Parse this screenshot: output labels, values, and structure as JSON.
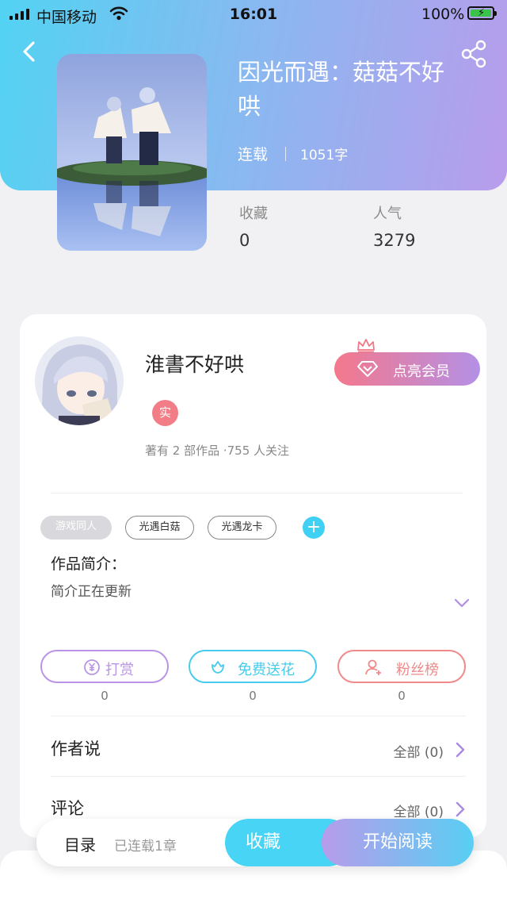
{
  "status_bar": {
    "carrier": "中国移动",
    "time": "16:01",
    "battery": "100%"
  },
  "book": {
    "title": "因光而遇：菇菇不好哄",
    "status": "连载",
    "word_count": "1051字",
    "stats": [
      {
        "label": "收藏",
        "value": "0"
      },
      {
        "label": "人气",
        "value": "3279"
      }
    ]
  },
  "author": {
    "name": "淮書不好哄",
    "badge": "实",
    "meta": "著有 2 部作品 ·755 人关注",
    "vip_button": "点亮会员"
  },
  "tags": [
    "游戏同人",
    "光遇白菇",
    "光遇龙卡"
  ],
  "intro": {
    "label": "作品简介：",
    "text": "简介正在更新"
  },
  "actions": [
    {
      "label": "打赏",
      "count": "0",
      "color": "#b994e6"
    },
    {
      "label": "免费送花",
      "count": "0",
      "color": "#47cbec"
    },
    {
      "label": "粉丝榜",
      "count": "0",
      "color": "#ef8a8a"
    }
  ],
  "sections": [
    {
      "label": "作者说",
      "more": "全部 (0)"
    },
    {
      "label": "评论",
      "more": "全部 (0)"
    }
  ],
  "bottom_bar": {
    "toc": "目录",
    "chapters": "已连载1章",
    "favorite": "收藏",
    "read": "开始阅读"
  },
  "colors": {
    "accent_cyan": "#48d4f5",
    "accent_purple": "#b79bea",
    "badge_red": "#f27d86"
  }
}
